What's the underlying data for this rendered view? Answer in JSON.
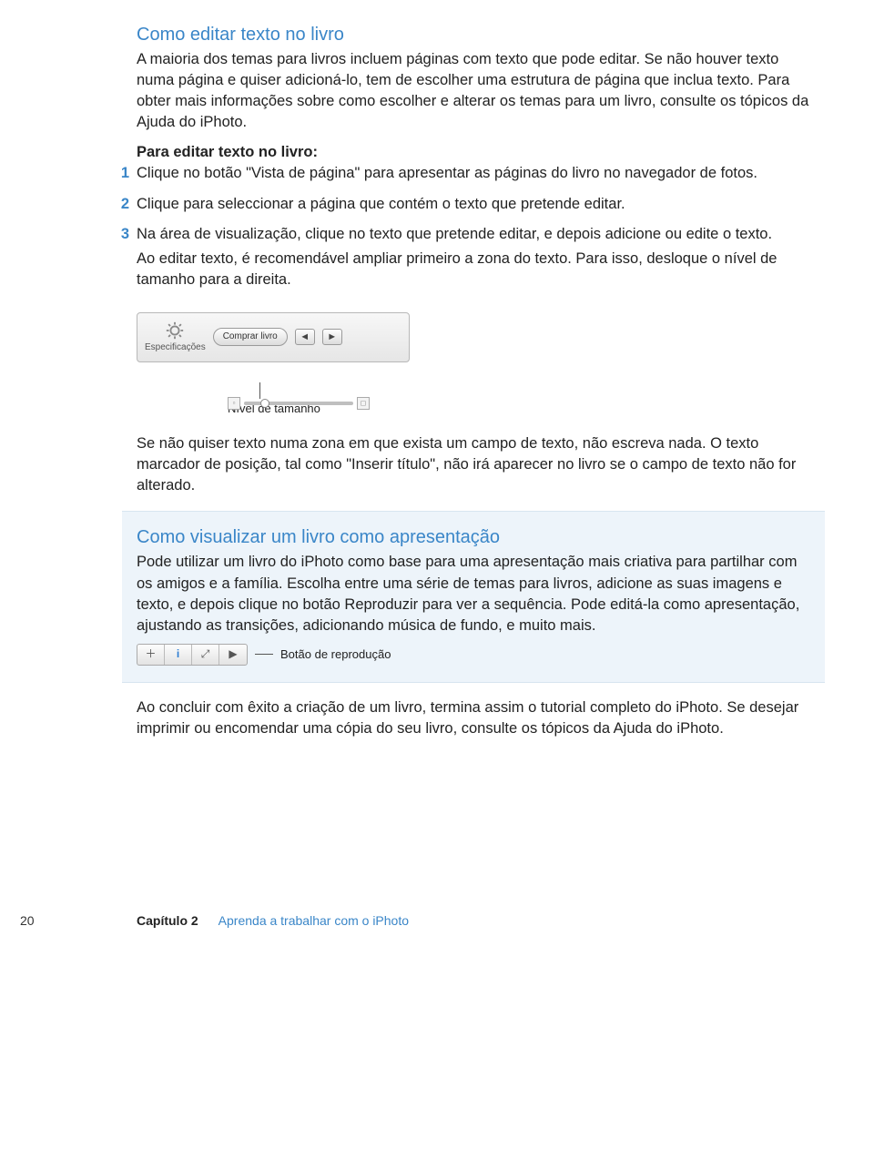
{
  "section1": {
    "heading": "Como editar texto no livro",
    "para1": "A maioria dos temas para livros incluem páginas com texto que pode editar. Se não houver texto numa página e quiser adicioná-lo, tem de escolher uma estrutura de página que inclua texto. Para obter mais informações sobre como escolher e alterar os temas para um livro, consulte os tópicos da Ajuda do iPhoto.",
    "lead": "Para editar texto no livro:",
    "steps": {
      "s1": "Clique no botão \"Vista de página\" para apresentar as páginas do livro no navegador de fotos.",
      "s2": "Clique para seleccionar a página que contém o texto que pretende editar.",
      "s3a": "Na área de visualização, clique no texto que pretende editar, e depois adicione ou edite o texto.",
      "s3b": "Ao editar texto, é recomendável ampliar primeiro a zona do texto. Para isso, desloque o nível de tamanho para a direita."
    },
    "nums": {
      "n1": "1",
      "n2": "2",
      "n3": "3"
    }
  },
  "toolbar": {
    "spec_label": "Especificações",
    "buy_label": "Comprar livro",
    "callout": "Nível de tamanho"
  },
  "para_after_toolbar": "Se não quiser texto numa zona em que exista um campo de texto, não escreva nada. O texto marcador de posição, tal como \"Inserir título\", não irá aparecer no livro se o campo de texto não for alterado.",
  "bluebox": {
    "heading": "Como visualizar um livro como apresentação",
    "para": "Pode utilizar um livro do iPhoto como base para uma apresentação mais criativa para partilhar com os amigos e a família. Escolha entre uma série de temas para livros, adicione as suas imagens e texto, e depois clique no botão Reproduzir para ver a sequência. Pode editá-la como apresentação, ajustando as transições, adicionando música de fundo, e muito mais.",
    "btn_callout": "Botão de reprodução"
  },
  "closing_para": "Ao concluir com êxito a criação de um livro, termina assim o tutorial completo do iPhoto. Se desejar imprimir ou encomendar uma cópia do seu livro, consulte os tópicos da Ajuda do iPhoto.",
  "footer": {
    "pagenum": "20",
    "chapter_bold": "Capítulo 2",
    "chapter_title": "Aprenda a trabalhar com o iPhoto"
  }
}
